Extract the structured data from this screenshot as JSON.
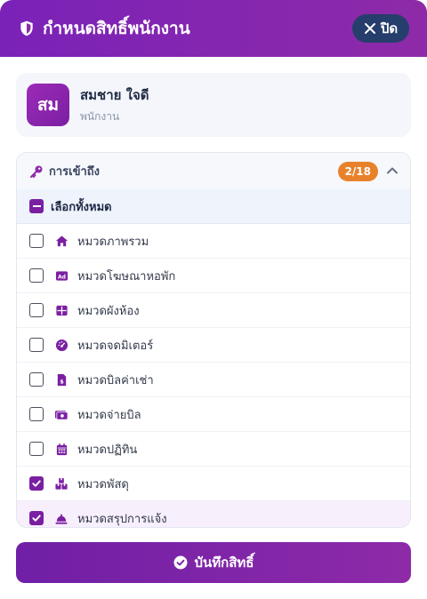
{
  "header": {
    "title": "กำหนดสิทธิ์พนักงาน",
    "close_label": "ปิด",
    "icon": "shield-icon"
  },
  "user": {
    "initials": "สม",
    "name": "สมชาย ใจดี",
    "role": "พนักงาน"
  },
  "panel": {
    "title": "การเข้าถึง",
    "badge": "2/18",
    "select_all_label": "เลือกทั้งหมด",
    "items": [
      {
        "label": "หมวดภาพรวม",
        "icon": "home-icon",
        "checked": false
      },
      {
        "label": "หมวดโฆษณาหอพัก",
        "icon": "ad-icon",
        "checked": false
      },
      {
        "label": "หมวดผังห้อง",
        "icon": "grid-icon",
        "checked": false
      },
      {
        "label": "หมวดจดมิเตอร์",
        "icon": "gauge-icon",
        "checked": false
      },
      {
        "label": "หมวดบิลค่าเช่า",
        "icon": "invoice-icon",
        "checked": false
      },
      {
        "label": "หมวดจ่ายบิล",
        "icon": "money-icon",
        "checked": false
      },
      {
        "label": "หมวดปฏิทิน",
        "icon": "calendar-icon",
        "checked": false
      },
      {
        "label": "หมวดพัสดุ",
        "icon": "boxes-icon",
        "checked": true
      },
      {
        "label": "หมวดสรุปการแจ้ง",
        "icon": "bell-icon",
        "checked": true
      }
    ]
  },
  "save_label": "บันทึกสิทธิ์",
  "colors": {
    "primary": "#7b1fa2",
    "badge": "#e8822a",
    "close_bg": "#263e6b"
  }
}
